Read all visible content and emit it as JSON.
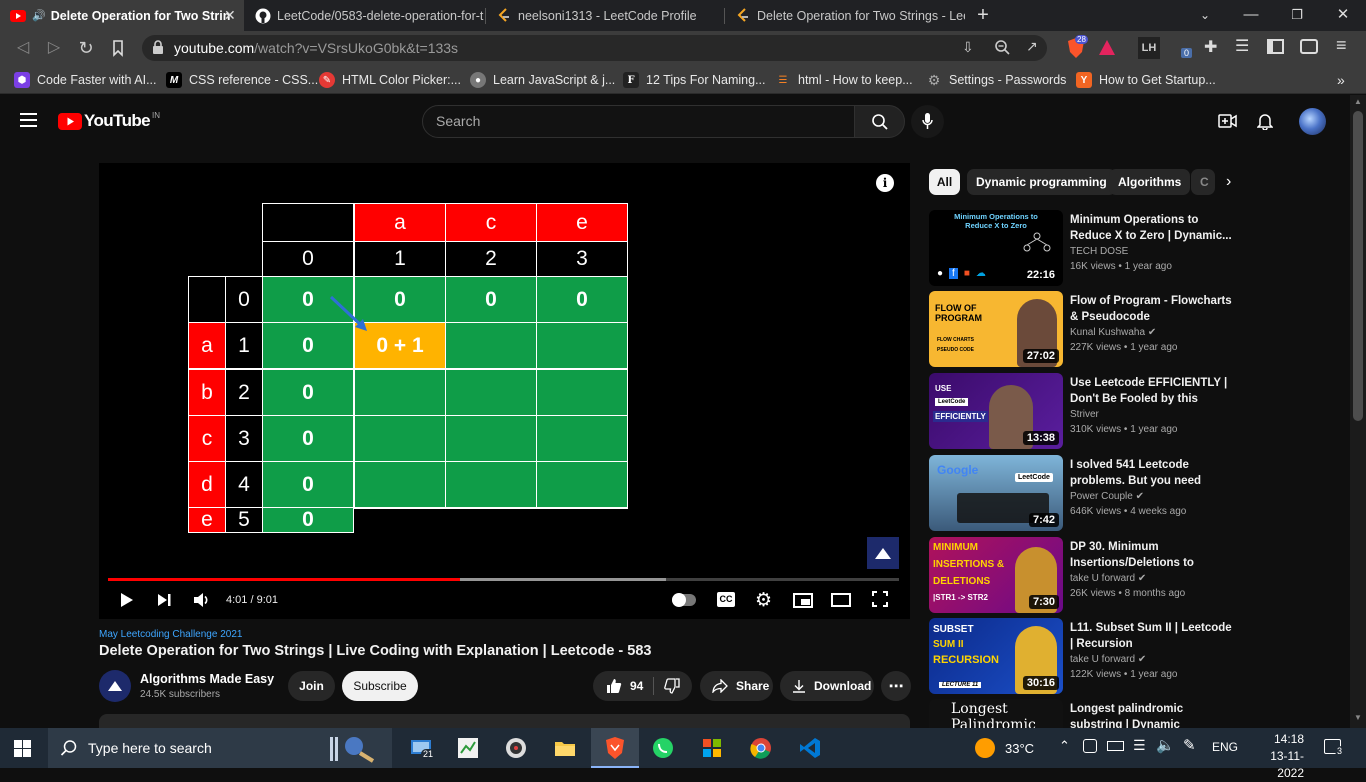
{
  "browser": {
    "tabs": [
      {
        "title": "Delete Operation for Two Strin",
        "active": true
      },
      {
        "title": "LeetCode/0583-delete-operation-for-t"
      },
      {
        "title": "neelsoni1313 - LeetCode Profile"
      },
      {
        "title": "Delete Operation for Two Strings - Lee"
      }
    ],
    "url_host": "youtube.com",
    "url_path": "/watch?v=VSrsUkoG0bk&t=133s",
    "brave_badge": "28",
    "ext_badge": "0",
    "bookmarks": [
      "Code Faster with AI...",
      "CSS reference - CSS...",
      "HTML Color Picker:...",
      "Learn JavaScript & j...",
      "12 Tips For Naming...",
      "html - How to keep...",
      "Settings - Passwords",
      "How to Get Startup..."
    ]
  },
  "youtube": {
    "logo_text": "YouTube",
    "region": "IN",
    "search_placeholder": "Search"
  },
  "video": {
    "time": "4:01 / 9:01",
    "progress": 0.445,
    "buffered": 0.705,
    "grid": {
      "col_letters": [
        "a",
        "c",
        "e"
      ],
      "col_indices": [
        "0",
        "1",
        "2",
        "3"
      ],
      "row_letters": [
        "a",
        "b",
        "c",
        "d",
        "e"
      ],
      "row_indices": [
        "0",
        "1",
        "2",
        "3",
        "4",
        "5"
      ],
      "first_row": [
        "0",
        "0",
        "0",
        "0"
      ],
      "first_col": [
        "0",
        "0",
        "0",
        "0",
        "0"
      ],
      "highlight": "0 + 1"
    },
    "playlist_label": "May Leetcoding Challenge 2021",
    "title": "Delete Operation for Two Strings | Live Coding with Explanation | Leetcode - 583",
    "channel": "Algorithms Made Easy",
    "subscribers": "24.5K subscribers",
    "join_label": "Join",
    "subscribe_label": "Subscribe",
    "likes": "94",
    "share_label": "Share",
    "download_label": "Download"
  },
  "chips": [
    "All",
    "Dynamic programming",
    "Algorithms",
    "C"
  ],
  "recommendations": [
    {
      "title": "Minimum Operations to Reduce X to Zero | Dynamic...",
      "channel": "TECH DOSE",
      "meta": "16K views • 1 year ago",
      "duration": "22:16",
      "verified": false
    },
    {
      "title": "Flow of Program - Flowcharts & Pseudocode",
      "channel": "Kunal Kushwaha",
      "meta": "227K views • 1 year ago",
      "duration": "27:02",
      "verified": true
    },
    {
      "title": "Use Leetcode EFFICIENTLY | Don't Be Fooled by this Featur...",
      "channel": "Striver",
      "meta": "310K views • 1 year ago",
      "duration": "13:38",
      "verified": false
    },
    {
      "title": "I solved 541 Leetcode problems. But you need only...",
      "channel": "Power Couple",
      "meta": "646K views • 4 weeks ago",
      "duration": "7:42",
      "verified": true
    },
    {
      "title": "DP 30. Minimum Insertions/Deletions to Conver...",
      "channel": "take U forward",
      "meta": "26K views • 8 months ago",
      "duration": "7:30",
      "verified": true
    },
    {
      "title": "L11. Subset Sum II | Leetcode | Recursion",
      "channel": "take U forward",
      "meta": "122K views • 1 year ago",
      "duration": "30:16",
      "verified": true
    },
    {
      "title": "Longest palindromic substring | Dynamic programming",
      "channel": "",
      "meta": "",
      "duration": "",
      "verified": false
    }
  ],
  "thumb_text": {
    "t1": "Minimum Operations to Reduce X to Zero",
    "t2a": "FLOW OF",
    "t2b": "PROGRAM",
    "t2c": "FLOW CHARTS",
    "t2d": "PSEUDO CODE",
    "t3a": "USE",
    "t3b": "LeetCode",
    "t3c": "EFFICIENTLY",
    "t4a": "Google",
    "t4b": "LeetCode",
    "t5a": "MINIMUM",
    "t5b": "INSERTIONS &",
    "t5c": "DELETIONS",
    "t5d": "|STR1 -> STR2",
    "t6a": "SUBSET",
    "t6b": "SUM II",
    "t6c": "RECURSION",
    "t6d": "LECTURE 11",
    "t7a": "Longest",
    "t7b": "Palindromic"
  },
  "taskbar": {
    "search_placeholder": "Type here to search",
    "weather": "33°C",
    "lang": "ENG",
    "time": "14:18",
    "date": "13-11-2022",
    "teams_badge": "21",
    "notif_badge": "3"
  }
}
